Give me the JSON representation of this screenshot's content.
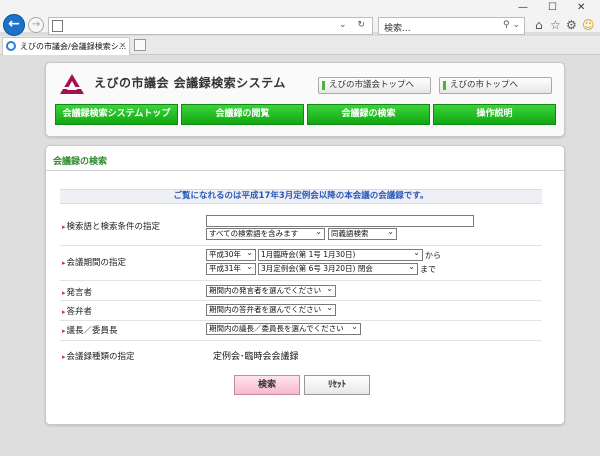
{
  "browser": {
    "search_placeholder": "検索...",
    "search_icon": "search-icon",
    "tab_title": "えびの市議会/会議録検索シ...",
    "win_minimize": "—",
    "win_maximize": "☐",
    "win_close": "✕"
  },
  "header": {
    "title": "えびの市議会 会議録検索システム",
    "top_links": [
      "えびの市議会トップへ",
      "えびの市トップへ"
    ],
    "nav": [
      "会議録検索システムトップ",
      "会議録の閲覧",
      "会議録の検索",
      "操作説明"
    ]
  },
  "search_panel": {
    "title": "会議録の検索",
    "notice": "ご覧になれるのは平成17年3月定例会以降の本会議の会議録です。",
    "keyword": {
      "label": "検索語と検索条件の指定",
      "value": "",
      "condition": "すべての検索語を含みます",
      "synonym": "同義語検索"
    },
    "period": {
      "label": "会議期間の指定",
      "from_era": "平成30年",
      "from_meeting": "1月臨時会(第 1号  1月30日)",
      "from_suffix": "から",
      "to_era": "平成31年",
      "to_meeting": "3月定例会(第 6号  3月20日)  閉会",
      "to_suffix": "まで"
    },
    "speaker": {
      "label": "発言者",
      "value": "期間内の発言者を選んでください"
    },
    "respondent": {
      "label": "答弁者",
      "value": "期間内の答弁者を選んでください"
    },
    "chair": {
      "label": "議長／委員長",
      "value": "期間内の議長／委員長を選んでください"
    },
    "type": {
      "label": "会議録種類の指定",
      "value": "定例会･臨時会会議録"
    },
    "search_button": "検索",
    "reset_button": "ﾘｾｯﾄ"
  }
}
